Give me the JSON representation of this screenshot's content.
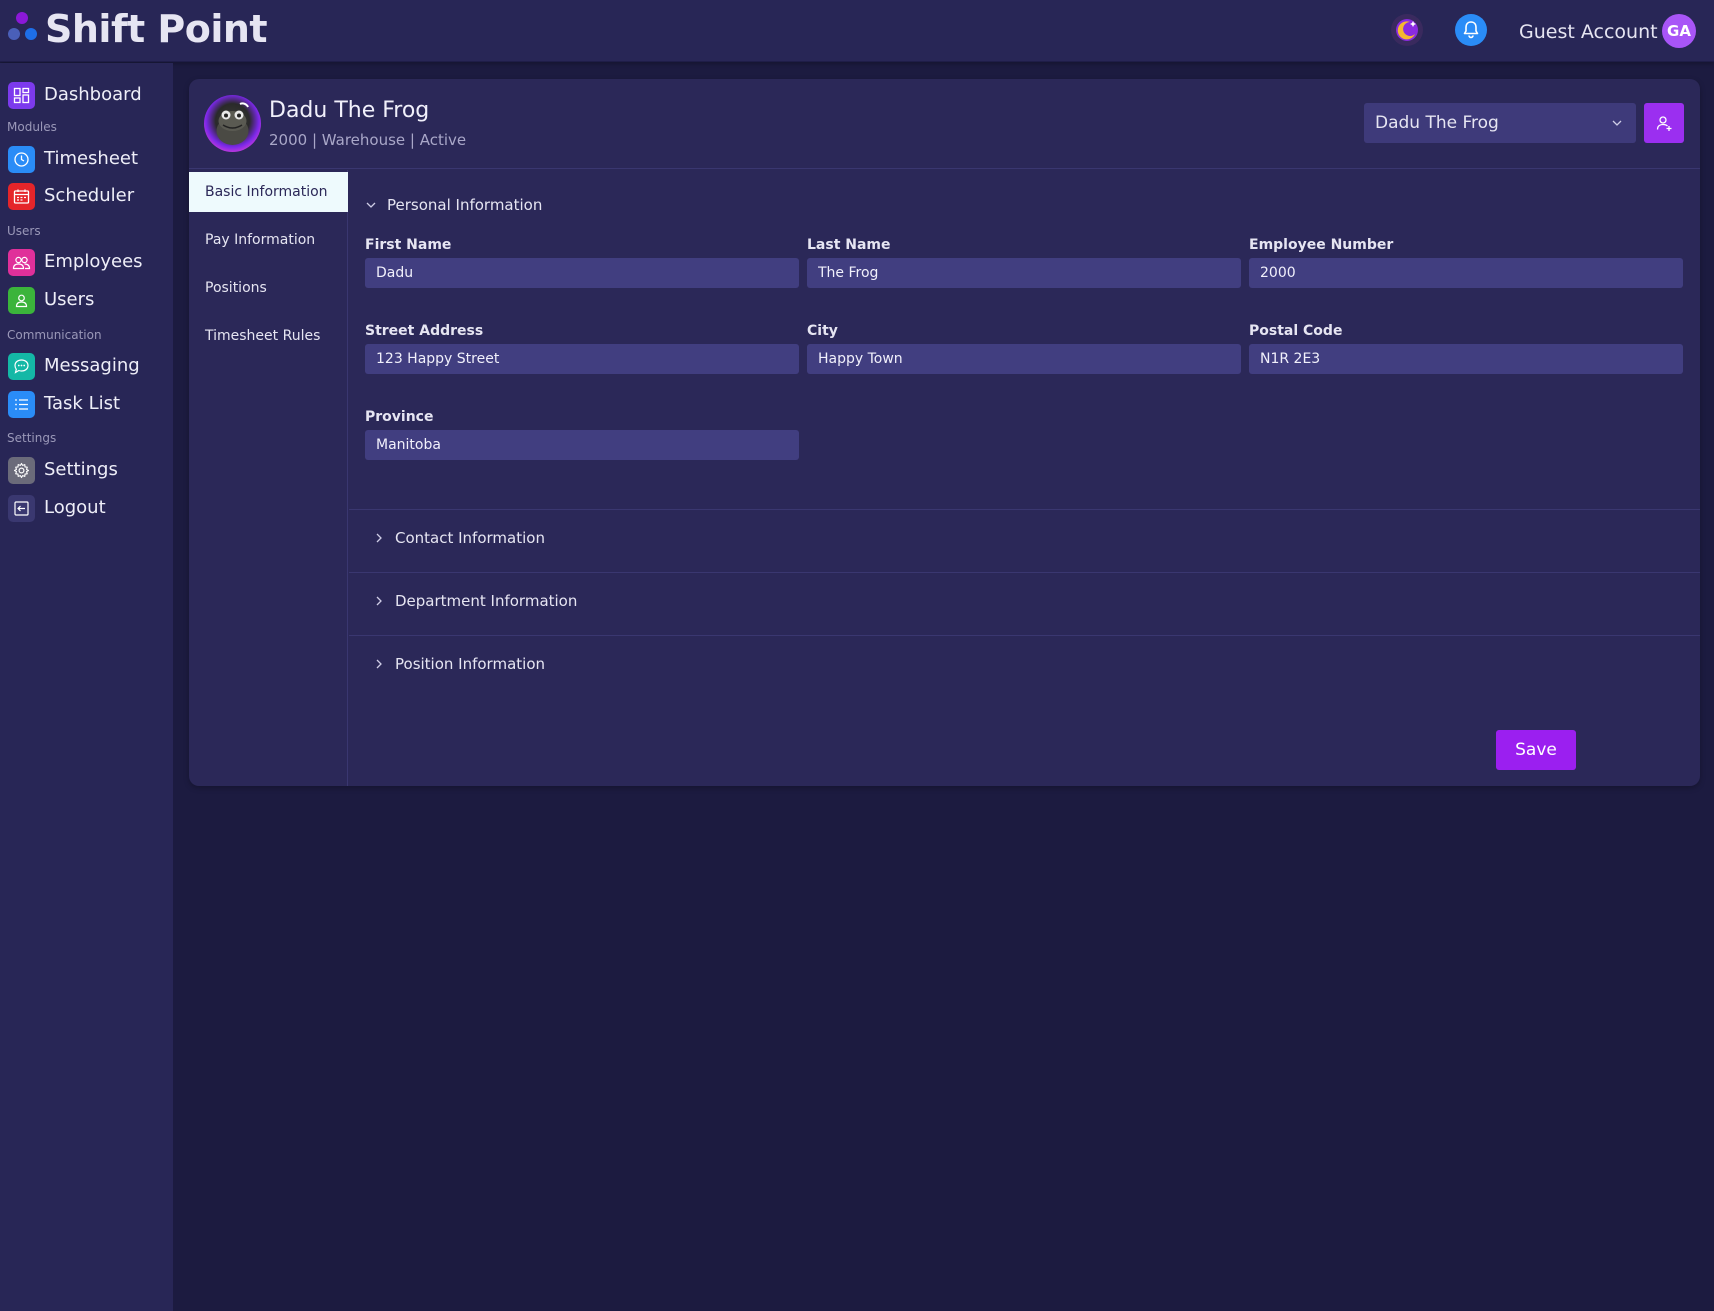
{
  "app": {
    "brand": "Shift Point",
    "account_name": "Guest Account",
    "account_initials": "GA"
  },
  "sidebar": {
    "items": [
      {
        "label": "Dashboard",
        "icon": "dashboard-icon",
        "color": "#7c3aed"
      },
      {
        "label": "Timesheet",
        "icon": "clock-icon",
        "color": "#2a8cf7"
      },
      {
        "label": "Scheduler",
        "icon": "calendar-icon",
        "color": "#e5252a"
      },
      {
        "label": "Employees",
        "icon": "users-icon",
        "color": "#e0309a"
      },
      {
        "label": "Users",
        "icon": "user-icon",
        "color": "#3bb43b"
      },
      {
        "label": "Messaging",
        "icon": "chat-icon",
        "color": "#14b8a6"
      },
      {
        "label": "Task List",
        "icon": "list-icon",
        "color": "#2a8cf7"
      },
      {
        "label": "Settings",
        "icon": "gear-icon",
        "color": "#6b6b7a"
      },
      {
        "label": "Logout",
        "icon": "logout-icon",
        "color": "#3a3870"
      }
    ],
    "sections": [
      "Modules",
      "Users",
      "Communication",
      "Settings"
    ]
  },
  "employee": {
    "name": "Dadu The Frog",
    "meta": "2000 | Warehouse | Active",
    "selected": "Dadu The Frog"
  },
  "tabs": [
    "Basic Information",
    "Pay Information",
    "Positions",
    "Timesheet Rules"
  ],
  "sections": {
    "personal": "Personal Information",
    "contact": "Contact Information",
    "department": "Department Information",
    "position": "Position Information"
  },
  "fields": {
    "first_name": {
      "label": "First Name",
      "value": "Dadu"
    },
    "last_name": {
      "label": "Last Name",
      "value": "The Frog"
    },
    "employee_number": {
      "label": "Employee Number",
      "value": "2000"
    },
    "street": {
      "label": "Street Address",
      "value": "123 Happy Street"
    },
    "city": {
      "label": "City",
      "value": "Happy Town"
    },
    "postal": {
      "label": "Postal Code",
      "value": "N1R 2E3"
    },
    "province": {
      "label": "Province",
      "value": "Manitoba"
    }
  },
  "actions": {
    "save": "Save"
  },
  "colors": {
    "accent": "#9b1ff0",
    "background": "#1c1b40",
    "panel": "#2b2858",
    "input": "#413e80"
  }
}
